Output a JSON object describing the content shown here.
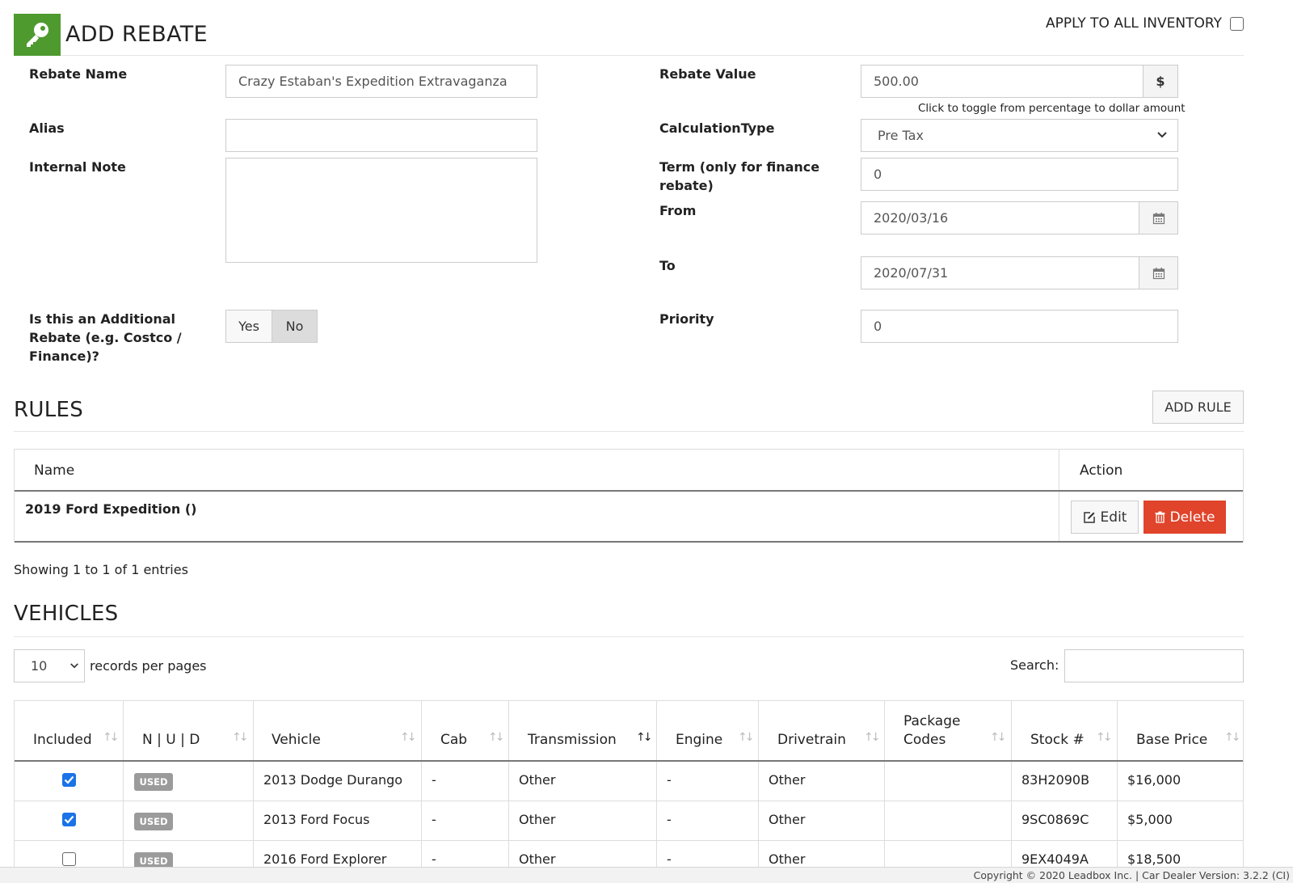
{
  "header": {
    "title": "ADD REBATE",
    "apply_all_label": "APPLY TO ALL INVENTORY",
    "apply_all_checked": false
  },
  "form": {
    "rebate_name_label": "Rebate Name",
    "rebate_name_value": "Crazy Estaban's Expedition Extravaganza",
    "alias_label": "Alias",
    "alias_value": "",
    "internal_note_label": "Internal Note",
    "internal_note_value": "",
    "additional_label": "Is this an Additional Rebate (e.g. Costco / Finance)?",
    "additional_yes": "Yes",
    "additional_no": "No",
    "additional_selected": "No",
    "rebate_value_label": "Rebate Value",
    "rebate_value": "500.00",
    "rebate_unit": "$",
    "toggle_hint": "Click to toggle from percentage to dollar amount",
    "calc_type_label": "CalculationType",
    "calc_type_value": "Pre Tax",
    "term_label": "Term (only for finance rebate)",
    "term_value": "0",
    "from_label": "From",
    "from_value": "2020/03/16",
    "to_label": "To",
    "to_value": "2020/07/31",
    "priority_label": "Priority",
    "priority_value": "0"
  },
  "rules": {
    "title": "RULES",
    "add_button": "ADD RULE",
    "col_name": "Name",
    "col_action": "Action",
    "rows": [
      {
        "name": "2019 Ford Expedition ()",
        "edit": "Edit",
        "delete": "Delete"
      }
    ],
    "showing": "Showing 1 to 1 of 1 entries"
  },
  "vehicles": {
    "title": "VEHICLES",
    "page_length": "10",
    "page_length_label": "records per pages",
    "search_label": "Search:",
    "search_value": "",
    "columns": [
      "Included",
      "N | U | D",
      "Vehicle",
      "Cab",
      "Transmission",
      "Engine",
      "Drivetrain",
      "Package Codes",
      "Stock #",
      "Base Price"
    ],
    "rows": [
      {
        "included": true,
        "status": "USED",
        "vehicle": "2013 Dodge Durango",
        "cab": "-",
        "transmission": "Other",
        "engine": "-",
        "drivetrain": "Other",
        "package": "",
        "stock": "83H2090B",
        "price": "$16,000"
      },
      {
        "included": true,
        "status": "USED",
        "vehicle": "2013 Ford Focus",
        "cab": "-",
        "transmission": "Other",
        "engine": "-",
        "drivetrain": "Other",
        "package": "",
        "stock": "9SC0869C",
        "price": "$5,000"
      },
      {
        "included": false,
        "status": "USED",
        "vehicle": "2016 Ford Explorer",
        "cab": "-",
        "transmission": "Other",
        "engine": "-",
        "drivetrain": "Other",
        "package": "",
        "stock": "9EX4049A",
        "price": "$18,500"
      }
    ]
  },
  "footer": {
    "text": "Copyright © 2020 Leadbox Inc. | Car Dealer Version: 3.2.2 (CI)"
  },
  "colors": {
    "brand_green": "#4e9a2f",
    "delete_red": "#e0442b",
    "checkbox_blue": "#1a73e8",
    "badge_gray": "#9b9b9b"
  },
  "icons": {
    "logo": "key-icon",
    "edit": "edit-icon",
    "delete": "trash-icon",
    "date": "calendar-icon",
    "select": "chevron-down-icon",
    "sort": "sort-icon"
  }
}
